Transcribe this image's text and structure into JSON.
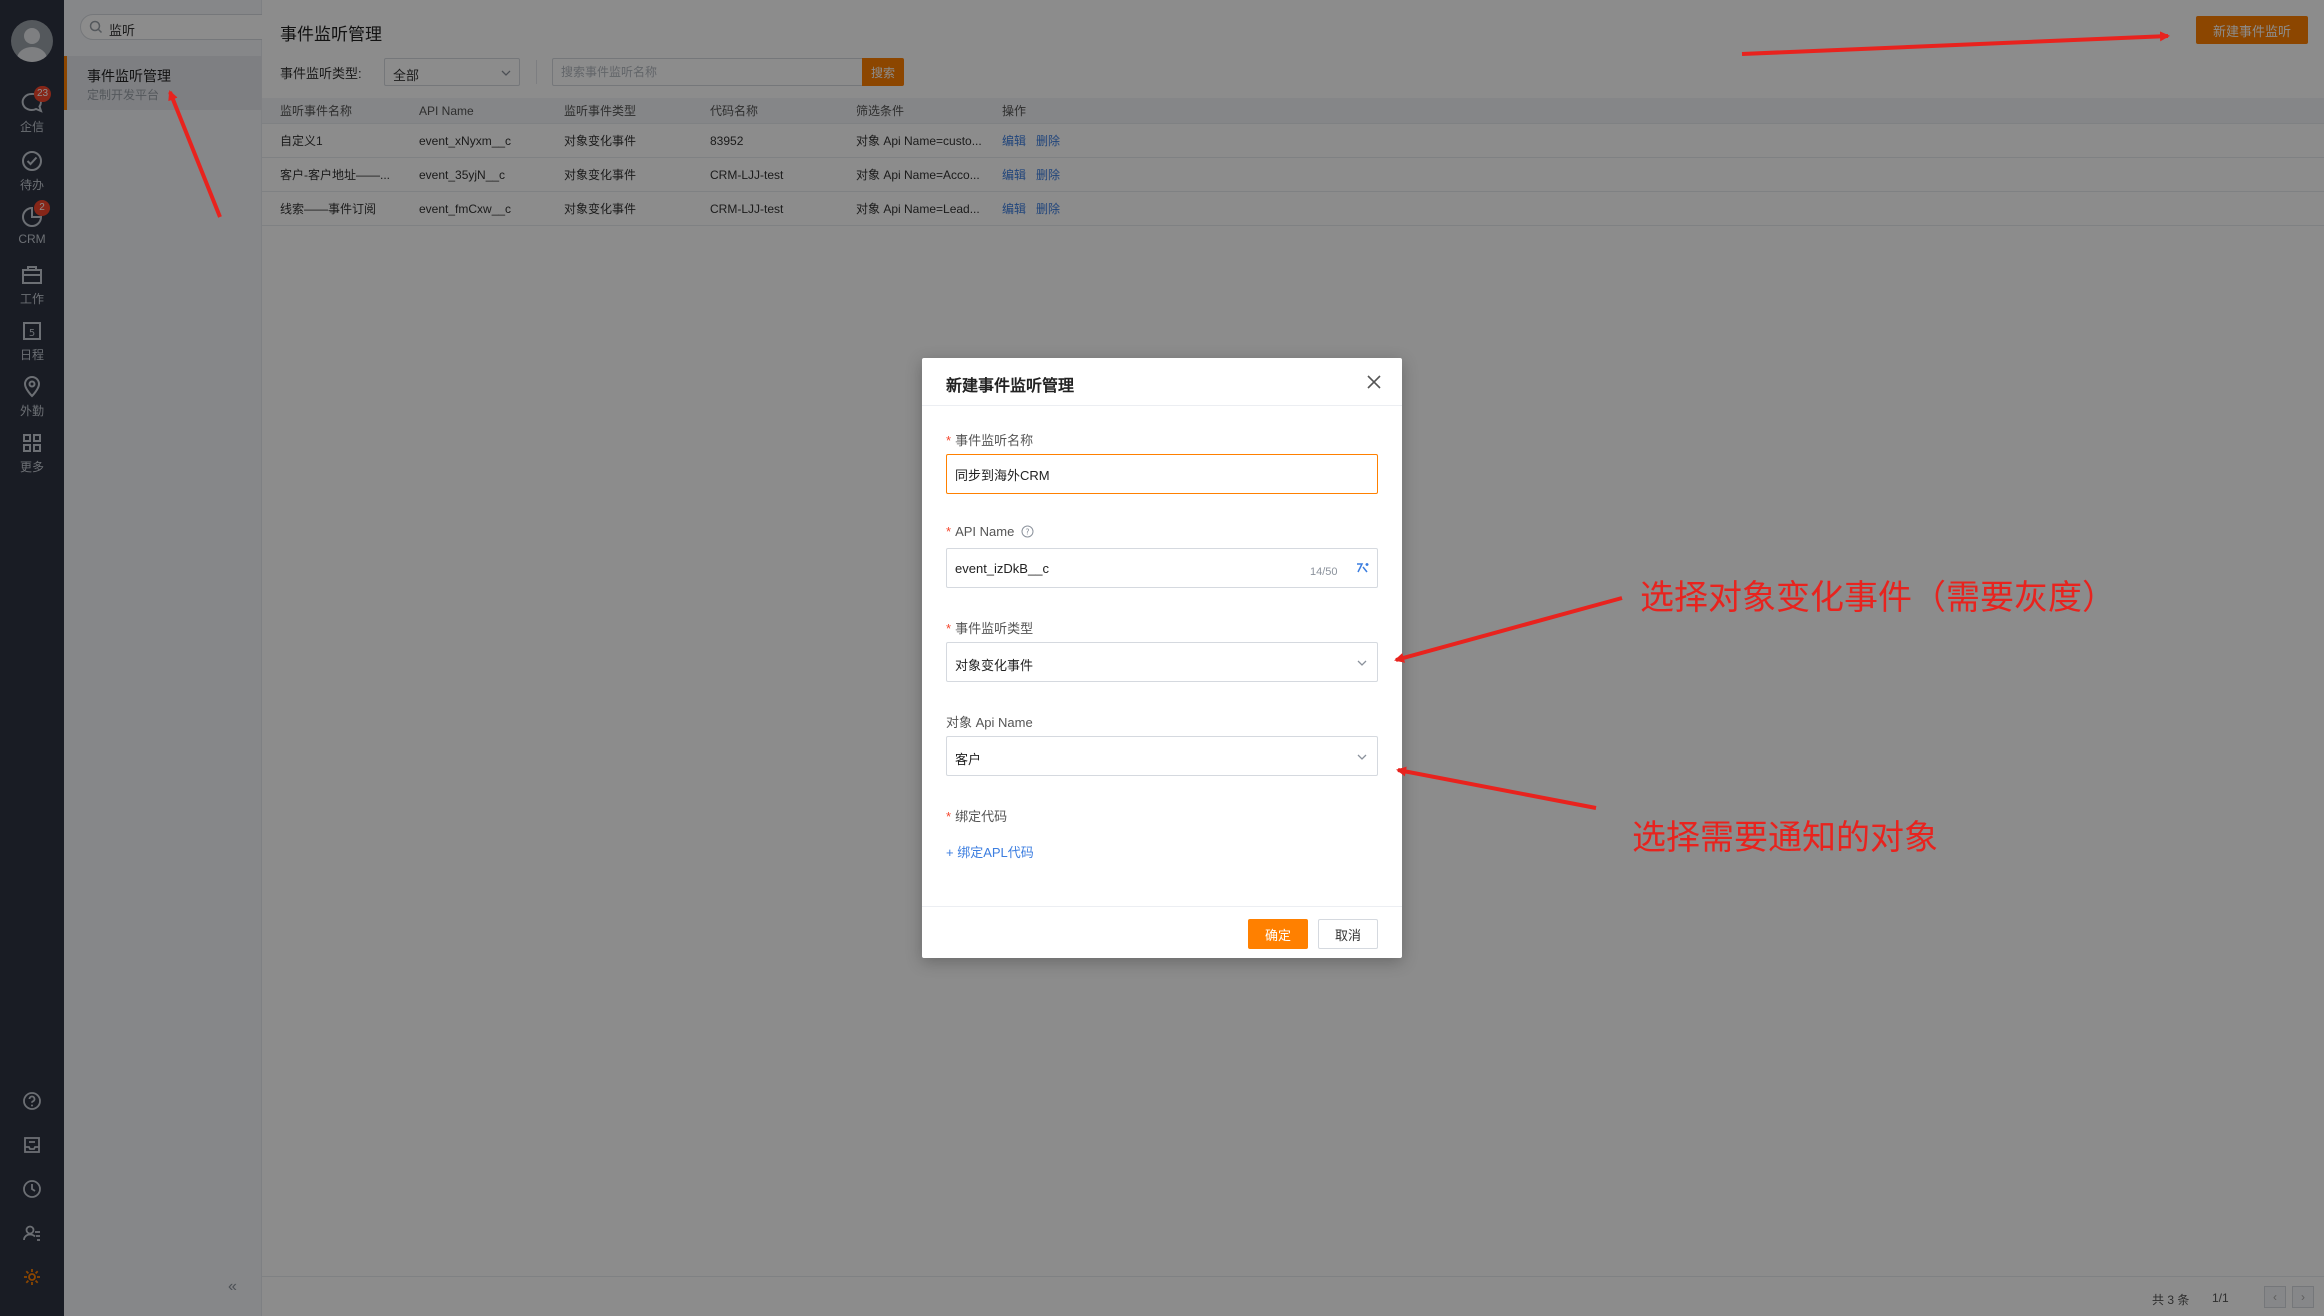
{
  "rail": {
    "items": [
      {
        "label": "企信",
        "icon": "chat-bubble-icon",
        "badge": "23"
      },
      {
        "label": "待办",
        "icon": "check-circle-icon",
        "badge": ""
      },
      {
        "label": "CRM",
        "icon": "crm-chart-icon",
        "badge": "2"
      },
      {
        "label": "工作",
        "icon": "briefcase-icon",
        "badge": ""
      },
      {
        "label": "日程",
        "icon": "calendar-icon",
        "badge": ""
      },
      {
        "label": "外勤",
        "icon": "location-pin-icon",
        "badge": ""
      },
      {
        "label": "更多",
        "icon": "grid-icon",
        "badge": ""
      }
    ],
    "bottom_icons": [
      "help-icon",
      "inbox-icon",
      "clock-icon",
      "user-settings-icon",
      "gear-icon"
    ]
  },
  "sidebar": {
    "search_value": "监听",
    "active_item": {
      "title": "事件监听管理",
      "subtitle": "定制开发平台"
    }
  },
  "main": {
    "title": "事件监听管理",
    "new_button": "新建事件监听",
    "filter_label": "事件监听类型:",
    "filter_value": "全部",
    "search_placeholder": "搜索事件监听名称",
    "search_button": "搜索",
    "table": {
      "headers": [
        "监听事件名称",
        "API Name",
        "监听事件类型",
        "代码名称",
        "筛选条件",
        "操作"
      ],
      "rows": [
        [
          "自定义1",
          "event_xNyxm__c",
          "对象变化事件",
          "83952",
          "对象 Api Name=custo..."
        ],
        [
          "客户-客户地址——...",
          "event_35yjN__c",
          "对象变化事件",
          "CRM-LJJ-test",
          "对象 Api Name=Acco..."
        ],
        [
          "线索——事件订阅",
          "event_fmCxw__c",
          "对象变化事件",
          "CRM-LJJ-test",
          "对象 Api Name=Lead..."
        ]
      ],
      "action_edit": "编辑",
      "action_delete": "删除"
    },
    "footer": {
      "total": "共 3 条",
      "page": "1/1"
    }
  },
  "dialog": {
    "title": "新建事件监听管理",
    "name_label": "事件监听名称",
    "name_value": "同步到海外CRM",
    "api_label": "API Name",
    "api_value": "event_izDkB__c",
    "api_counter": "14/50",
    "type_label": "事件监听类型",
    "type_value": "对象变化事件",
    "object_label": "对象 Api Name",
    "object_value": "客户",
    "code_label": "绑定代码",
    "bind_link": "绑定APL代码",
    "ok": "确定",
    "cancel": "取消"
  },
  "annotations": {
    "note1": "选择对象变化事件（需要灰度）",
    "note2": "选择需要通知的对象",
    "color": "#e8231e"
  },
  "colors": {
    "accent": "#ff8000",
    "link": "#3c7ee0",
    "rail": "#2e3442"
  }
}
